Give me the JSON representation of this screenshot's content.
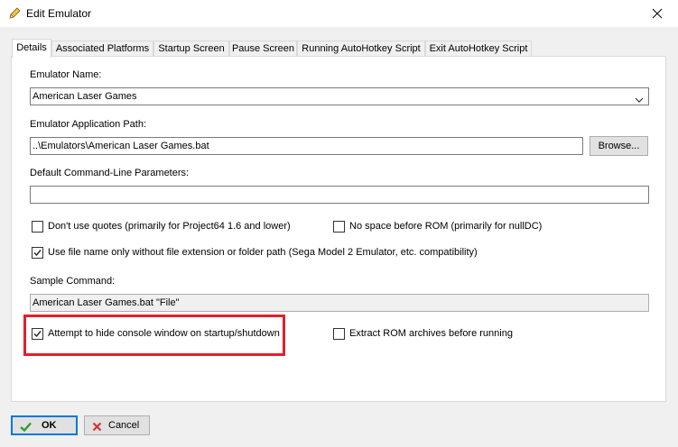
{
  "window": {
    "title": "Edit Emulator"
  },
  "tabs": [
    {
      "label": "Details",
      "active": true
    },
    {
      "label": "Associated Platforms",
      "active": false
    },
    {
      "label": "Startup Screen",
      "active": false
    },
    {
      "label": "Pause Screen",
      "active": false
    },
    {
      "label": "Running AutoHotkey Script",
      "active": false
    },
    {
      "label": "Exit AutoHotkey Script",
      "active": false
    }
  ],
  "details": {
    "emulator_name_label": "Emulator Name:",
    "emulator_name_value": "American Laser Games",
    "app_path_label": "Emulator Application Path:",
    "app_path_value": "..\\Emulators\\American Laser Games.bat",
    "browse_label": "Browse...",
    "params_label": "Default Command-Line Parameters:",
    "params_value": "",
    "options": {
      "dont_use_quotes": {
        "label": "Don't use quotes (primarily for Project64 1.6 and lower)",
        "checked": false
      },
      "no_space_before_rom": {
        "label": "No space before ROM (primarily for nullDC)",
        "checked": false
      },
      "file_name_only": {
        "label": "Use file name only without file extension or folder path (Sega Model 2 Emulator, etc. compatibility)",
        "checked": true
      },
      "hide_console": {
        "label": "Attempt to hide console window on startup/shutdown",
        "checked": true
      },
      "extract_rom": {
        "label": "Extract ROM archives before running",
        "checked": false
      }
    },
    "sample_command_label": "Sample Command:",
    "sample_command_value": "American Laser Games.bat \"File\""
  },
  "footer": {
    "ok_label": "OK",
    "cancel_label": "Cancel"
  },
  "colors": {
    "highlight": "#e32028",
    "ok_check": "#2e9c2e",
    "cancel_x": "#d13438",
    "focus": "#0078d7"
  }
}
